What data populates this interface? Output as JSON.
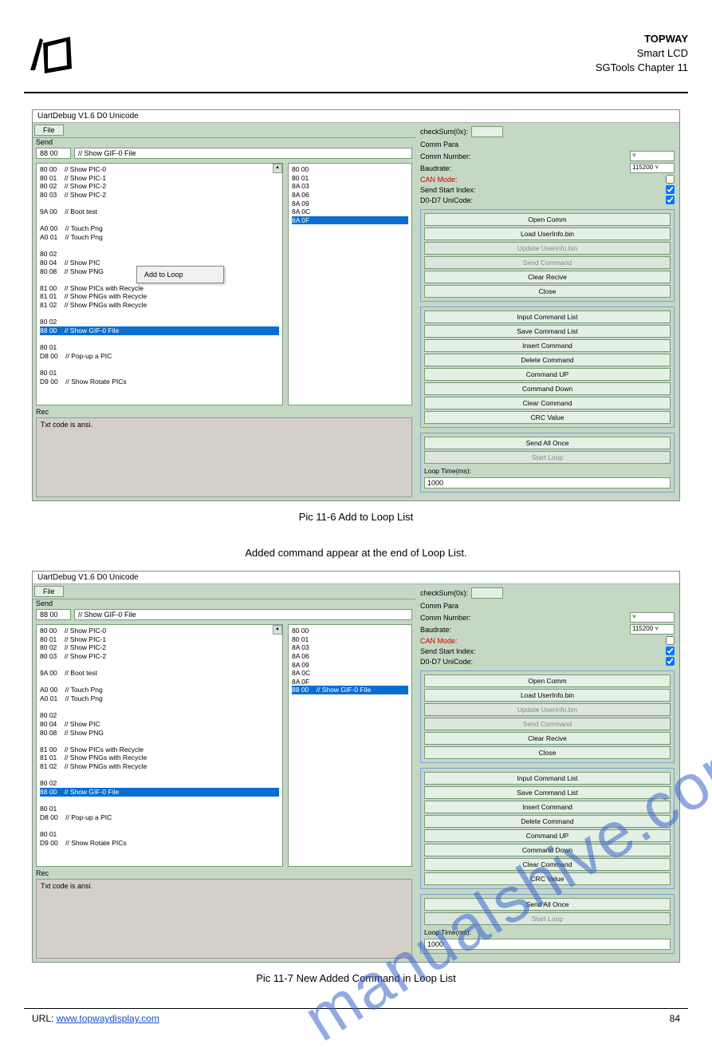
{
  "header": {
    "company": "TOPWAY",
    "product_title": "Smart LCD",
    "subtitle": "SGTools Chapter 11"
  },
  "caption1": "Pic 11-6 Add to Loop List",
  "caption2": "Added command appear at the end of Loop List.",
  "caption3": "Pic 11-7 New Added Command in Loop List",
  "app": {
    "title": "UartDebug V1.6 D0 Unicode",
    "file_btn": "File",
    "send_label": "Send",
    "send_code": "88 00",
    "send_desc": "// Show GIF-0 File",
    "rec_label": "Rec",
    "rec_text": "Txt code is ansi.",
    "checksum_label": "checkSum(0x):",
    "params_title": "Comm Para",
    "param_rows": [
      {
        "label": "Comm Number:",
        "type": "select",
        "value": ""
      },
      {
        "label": "Baudrate:",
        "type": "select",
        "value": "115200"
      },
      {
        "label": "CAN Mode:",
        "type": "check",
        "value": false,
        "can": true
      },
      {
        "label": "Send Start Index:",
        "type": "check",
        "value": true
      },
      {
        "label": "D0-D7 UniCode:",
        "type": "check",
        "value": true
      }
    ],
    "btns1": [
      "Open Comm",
      "Load UserInfo.bin"
    ],
    "btns1_disabled": [
      "Update Userinfo.bin",
      "Send Command"
    ],
    "btns1b": [
      "Clear Recive",
      "Close"
    ],
    "btns2": [
      "Input Command List",
      "Save Command List",
      "Insert Command",
      "Delete Command",
      "Command UP",
      "Command Down",
      "Clear Command",
      "CRC Value"
    ],
    "btns3": [
      "Send All Once"
    ],
    "btns3_disabled": [
      "Start Loop"
    ],
    "loop_time_label": "Loop Time(ms):",
    "loop_time_value": "1000",
    "ctx_menu": "Add to Loop",
    "cmd_list": [
      "80 00    // Show PIC-0",
      "80 01    // Show PIC-1",
      "80 02    // Show PIC-2",
      "80 03    // Show PIC-2",
      "",
      "9A 00    // Boot test",
      "",
      "A0 00    // Touch Png",
      "A0 01    // Touch Png",
      "",
      "80 02",
      "80 04    // Show PIC",
      "80 08    // Show PNG",
      "",
      "81 00    // Show PICs with Recycle",
      "81 01    // Show PNGs with Recycle",
      "81 02    // Show PNGs with Recycle",
      "",
      "80 02",
      "88 00    // Show GIF-0 File",
      "",
      "80 01",
      "D8 00    // Pop-up a PIC",
      "",
      "80 01",
      "D9 00    // Show Rotate PICs"
    ],
    "cmd_list_sel_index": 19,
    "loop_list_a": [
      "80 00",
      "80 01",
      "8A 03",
      "8A 06",
      "8A 09",
      "8A 0C",
      "8A 0F"
    ],
    "loop_list_a_sel_index": 6,
    "loop_list_b": [
      "80 00",
      "80 01",
      "8A 03",
      "8A 06",
      "8A 09",
      "8A 0C",
      "8A 0F",
      "88 00    // Show GIF-0 File"
    ],
    "loop_list_b_sel_index": 7
  },
  "footer": {
    "url_label": "URL:",
    "url": "www.topwaydisplay.com",
    "page": "84"
  }
}
